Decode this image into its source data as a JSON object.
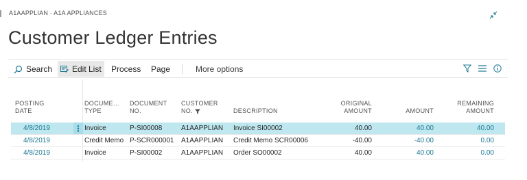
{
  "context": "A1AAPPLIAN · A1A APPLIANCES",
  "title": "Customer Ledger Entries",
  "actions": {
    "search": "Search",
    "edit_list": "Edit List",
    "process": "Process",
    "page": "Page",
    "more_options": "More options"
  },
  "icons": {
    "search": "search-icon",
    "edit_list": "edit-list-icon",
    "filter": "filter-icon",
    "list": "list-view-icon",
    "info": "info-icon",
    "collapse": "collapse-icon"
  },
  "columns": {
    "posting_date": [
      "POSTING",
      "DATE"
    ],
    "document_type": [
      "DOCUME…",
      "TYPE"
    ],
    "document_no": [
      "DOCUMENT",
      "NO."
    ],
    "customer_no": [
      "CUSTOMER",
      "NO."
    ],
    "description": "DESCRIPTION",
    "original_amount": [
      "ORIGINAL",
      "AMOUNT"
    ],
    "amount": "AMOUNT",
    "remaining_amount": [
      "REMAINING",
      "AMOUNT"
    ]
  },
  "rows": [
    {
      "posting_date": "4/8/2019",
      "document_type": "Invoice",
      "document_no": "P-SI00008",
      "customer_no": "A1AAPPLIAN",
      "description": "Invoice SI00002",
      "original_amount": "40.00",
      "amount": "40.00",
      "remaining_amount": "40.00",
      "selected": true
    },
    {
      "posting_date": "4/8/2019",
      "document_type": "Credit Memo",
      "document_no": "P-SCR000001",
      "customer_no": "A1AAPPLIAN",
      "description": "Credit Memo SCR00006",
      "original_amount": "-40.00",
      "amount": "-40.00",
      "remaining_amount": "0.00",
      "selected": false
    },
    {
      "posting_date": "4/8/2019",
      "document_type": "Invoice",
      "document_no": "P-SI00002",
      "customer_no": "A1AAPPLIAN",
      "description": "Order SO00002",
      "original_amount": "40.00",
      "amount": "40.00",
      "remaining_amount": "0.00",
      "selected": false
    }
  ],
  "colors": {
    "link": "#1b7894",
    "selected_row": "#bfe7ef"
  }
}
